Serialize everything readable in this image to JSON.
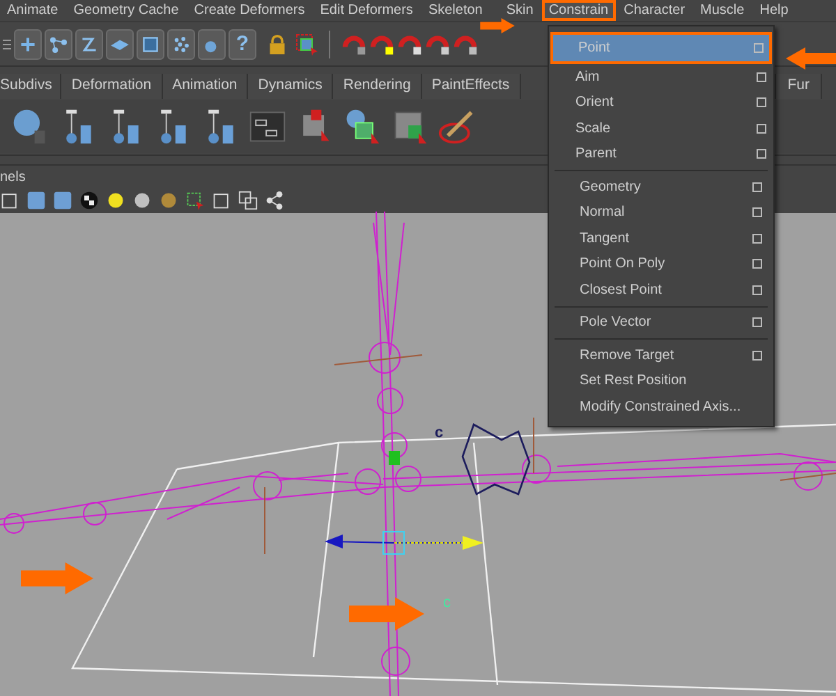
{
  "menu_bar": [
    {
      "label": "Animate",
      "selected": false
    },
    {
      "label": "Geometry Cache",
      "selected": false
    },
    {
      "label": "Create Deformers",
      "selected": false
    },
    {
      "label": "Edit Deformers",
      "selected": false
    },
    {
      "label": "Skeleton",
      "selected": false
    },
    {
      "label": "Skin",
      "selected": false
    },
    {
      "label": "Constrain",
      "selected": true
    },
    {
      "label": "Character",
      "selected": false
    },
    {
      "label": "Muscle",
      "selected": false
    },
    {
      "label": "Help",
      "selected": false
    }
  ],
  "help_button": {
    "label": "?"
  },
  "shelf_tabs": [
    {
      "label": "Subdivs"
    },
    {
      "label": "Deformation"
    },
    {
      "label": "Animation"
    },
    {
      "label": "Dynamics"
    },
    {
      "label": "Rendering"
    },
    {
      "label": "PaintEffects"
    }
  ],
  "shelf_tab_right": {
    "label": "Fur"
  },
  "panel_menu": {
    "label": "nels"
  },
  "constrain_menu": {
    "groups": [
      [
        {
          "label": "Point",
          "selected": true,
          "option_box": true
        },
        {
          "label": "Aim",
          "selected": false,
          "option_box": true
        },
        {
          "label": "Orient",
          "selected": false,
          "option_box": true
        },
        {
          "label": "Scale",
          "selected": false,
          "option_box": true
        },
        {
          "label": "Parent",
          "selected": false,
          "option_box": true
        }
      ],
      [
        {
          "label": "Geometry",
          "selected": false,
          "option_box": true
        },
        {
          "label": "Normal",
          "selected": false,
          "option_box": true
        },
        {
          "label": "Tangent",
          "selected": false,
          "option_box": true
        },
        {
          "label": "Point On Poly",
          "selected": false,
          "option_box": true
        },
        {
          "label": "Closest Point",
          "selected": false,
          "option_box": true
        }
      ],
      [
        {
          "label": "Pole Vector",
          "selected": false,
          "option_box": true
        }
      ],
      [
        {
          "label": "Remove Target",
          "selected": false,
          "option_box": true
        },
        {
          "label": "Set Rest Position",
          "selected": false,
          "option_box": false
        },
        {
          "label": "Modify Constrained Axis...",
          "selected": false,
          "option_box": false
        }
      ]
    ]
  },
  "viewport_labels": [
    {
      "text": "c",
      "color": "#1c1c5c"
    },
    {
      "text": "c",
      "color": "#44e8a0"
    }
  ]
}
